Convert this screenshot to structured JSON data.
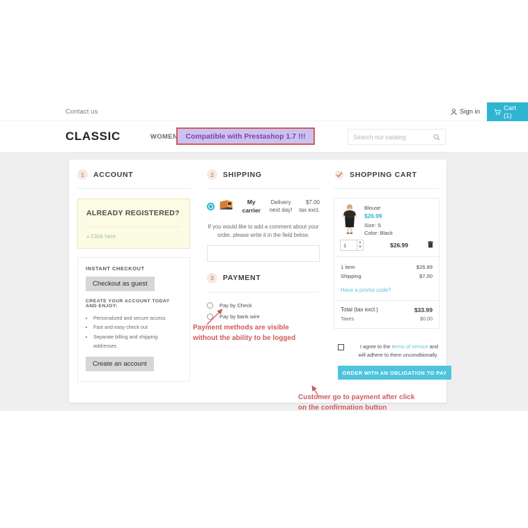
{
  "header": {
    "contact_us": "Contact us",
    "sign_in": "Sign in",
    "sign_in_icon": "user-icon",
    "cart_label": "Cart (1)",
    "cart_icon": "shopping-cart-icon",
    "logo": "CLASSIC",
    "nav_women": "WOMEN",
    "compat_banner": "Compatible with Prestashop 1.7 !!!",
    "compat_banner_bg": "#ccc2f0",
    "compat_banner_border": "#cf5b5b",
    "compat_banner_color": "#7c3fa8",
    "search_placeholder": "Search our catalog",
    "search_icon": "magnifier-icon",
    "cart_accent": "#2fb5d2"
  },
  "account": {
    "step_num": "1",
    "title": "ACCOUNT",
    "registered_title": "ALREADY REGISTERED?",
    "registered_link": "» Click here",
    "instant_checkout_head": "INSTANT CHECKOUT",
    "checkout_guest_btn": "Checkout as guest",
    "enjoy_head": "CREATE YOUR ACCOUNT TODAY AND ENJOY:",
    "benefits": [
      "Personalized and secure access",
      "Fast and easy check out",
      "Separate billing and shipping addresses"
    ],
    "create_account_btn": "Create an account"
  },
  "shipping": {
    "step_num": "2",
    "title": "SHIPPING",
    "carrier_icon": "delivery-truck-icon",
    "carrier_name": "My carrier",
    "carrier_delay": "Delivery next day!",
    "carrier_price": "$7.00",
    "carrier_tax_note": "tax excl.",
    "comment_note": "If you would like to add a comment about your order, please write it in the field below.",
    "comment_value": ""
  },
  "payment": {
    "step_num": "3",
    "title": "PAYMENT",
    "options": [
      {
        "label": "Pay by Check",
        "selected": false
      },
      {
        "label": "Pay by bank wire",
        "selected": false
      }
    ]
  },
  "cart": {
    "title": "SHOPPING CART",
    "check_icon": "check-mark-icon",
    "product": {
      "name": "Blouse",
      "price": "$26.99",
      "size_label": "Size: S",
      "color_label": "Color: Black",
      "qty": "1",
      "line_total": "$26.99",
      "delete_icon": "trash-icon",
      "thumb_alt": "blouse-product-thumbnail"
    },
    "summary": [
      {
        "label": "1 item",
        "value": "$26.99"
      },
      {
        "label": "Shipping",
        "value": "$7.00"
      }
    ],
    "promo_link": "Have a promo code?",
    "total_label": "Total (tax excl.)",
    "total_value": "$33.99",
    "taxes_label": "Taxes",
    "taxes_value": "$0.00",
    "terms_pre": "I agree to the ",
    "terms_link": "terms of service",
    "terms_post": " and will adhere to them unconditionally.",
    "order_btn": "ORDER WITH AN OBLIGATION TO PAY",
    "order_btn_color": "#4fc4dd"
  },
  "annotations": {
    "color": "#cf5b5b",
    "payment_note_line1": "Payment methods are visible",
    "payment_note_line2": "without the ability to be logged",
    "order_note_line1": "Customer go to payment after click",
    "order_note_line2": "on the confirmation button"
  }
}
